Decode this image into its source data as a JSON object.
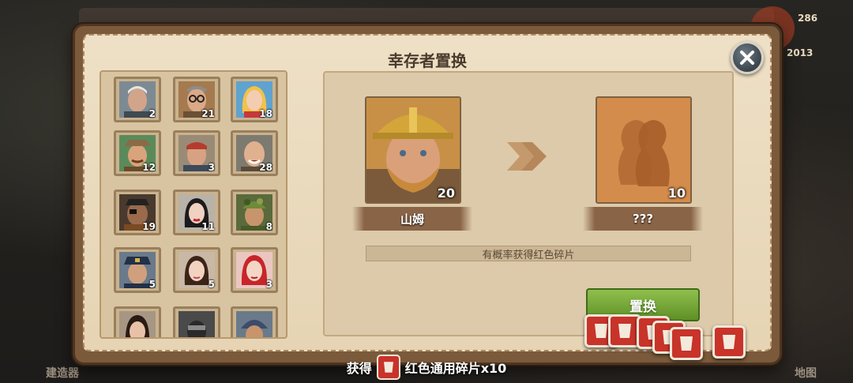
{
  "dialog": {
    "title": "幸存者置换",
    "close_icon": "close-icon"
  },
  "background": {
    "counter_top": "286",
    "counter_second": "2013",
    "left_label": "建造器",
    "right_label": "地图"
  },
  "roster": [
    {
      "name": "survivor-old-man",
      "count": "2"
    },
    {
      "name": "survivor-glasses-man",
      "count": "21"
    },
    {
      "name": "survivor-blonde-girl",
      "count": "18"
    },
    {
      "name": "survivor-cowboy",
      "count": "12"
    },
    {
      "name": "survivor-bandana-man",
      "count": "3"
    },
    {
      "name": "survivor-bald-man",
      "count": "28"
    },
    {
      "name": "survivor-eyepatch-man",
      "count": "19"
    },
    {
      "name": "survivor-black-hair-woman",
      "count": "11"
    },
    {
      "name": "survivor-camo-soldier",
      "count": "8"
    },
    {
      "name": "survivor-police-man",
      "count": "5"
    },
    {
      "name": "survivor-brunette-woman",
      "count": "5"
    },
    {
      "name": "survivor-red-hair-woman",
      "count": "3"
    },
    {
      "name": "survivor-dark-hair-woman",
      "count": ""
    },
    {
      "name": "survivor-masked-man",
      "count": ""
    },
    {
      "name": "survivor-helmet-soldier",
      "count": ""
    }
  ],
  "swap": {
    "source": {
      "name": "山姆",
      "count": "20"
    },
    "target": {
      "name": "???",
      "count": "10"
    },
    "hint": "有概率获得红色碎片",
    "button_label": "置换",
    "arrow_icon": "double-chevron-right-icon"
  },
  "reward": {
    "prefix": "获得",
    "item": "红色通用碎片x10",
    "icon": "red-fragment-icon"
  },
  "colors": {
    "panel_bg": "#e6d4b4",
    "frame": "#7a5a3a",
    "button_green": "#6fa533",
    "fragment_red": "#c8332a"
  }
}
